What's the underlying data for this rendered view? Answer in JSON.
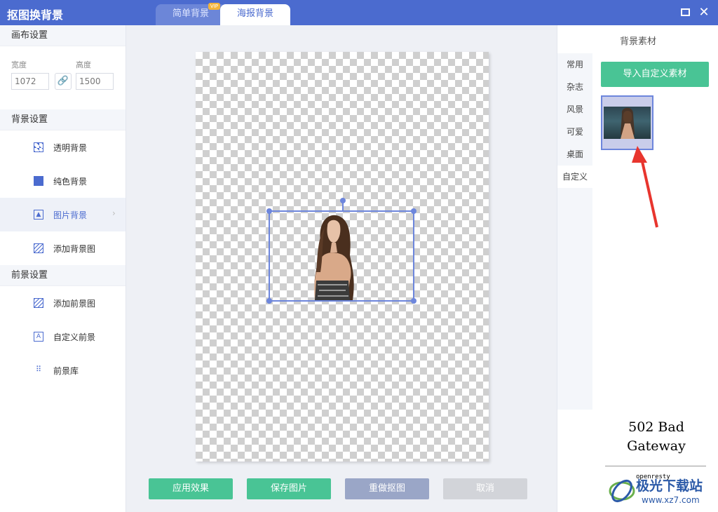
{
  "window": {
    "title": "抠图换背景",
    "tabs": [
      {
        "label": "简单背景",
        "badge": "VIP"
      },
      {
        "label": "海报背景"
      }
    ],
    "maximize_icon": "maximize-icon",
    "close_icon": "close-icon"
  },
  "left": {
    "canvas_section": "画布设置",
    "width_label": "宽度",
    "width_value": "1072",
    "height_label": "高度",
    "height_value": "1500",
    "link_icon": "link-icon",
    "background_section": "背景设置",
    "background_items": [
      {
        "label": "透明背景",
        "icon": "transparent-icon"
      },
      {
        "label": "纯色背景",
        "icon": "solid-color-icon"
      },
      {
        "label": "图片背景",
        "icon": "image-icon",
        "active": true
      },
      {
        "label": "添加背景图",
        "icon": "hatch-icon"
      }
    ],
    "foreground_section": "前景设置",
    "foreground_items": [
      {
        "label": "添加前景图",
        "icon": "add-foreground-icon"
      },
      {
        "label": "自定义前景",
        "icon": "text-a-icon"
      },
      {
        "label": "前景库",
        "icon": "library-icon"
      }
    ]
  },
  "actions": {
    "apply": "应用效果",
    "save": "保存图片",
    "redo": "重做抠图",
    "cancel": "取消"
  },
  "right": {
    "title": "背景素材",
    "categories": [
      "常用",
      "杂志",
      "风景",
      "可爱",
      "桌面",
      "自定义"
    ],
    "active_category": "自定义",
    "import_button": "导入自定义素材"
  },
  "overlay": {
    "error_line1": "502 Bad",
    "error_line2": "Gateway",
    "server": "openresty",
    "watermark_name": "极光下载站",
    "watermark_url": "www.xz7.com"
  },
  "colors": {
    "titlebar": "#4b6bcf",
    "accent_green": "#49c495",
    "selection": "#6d86dc",
    "arrow": "#e8352e"
  }
}
